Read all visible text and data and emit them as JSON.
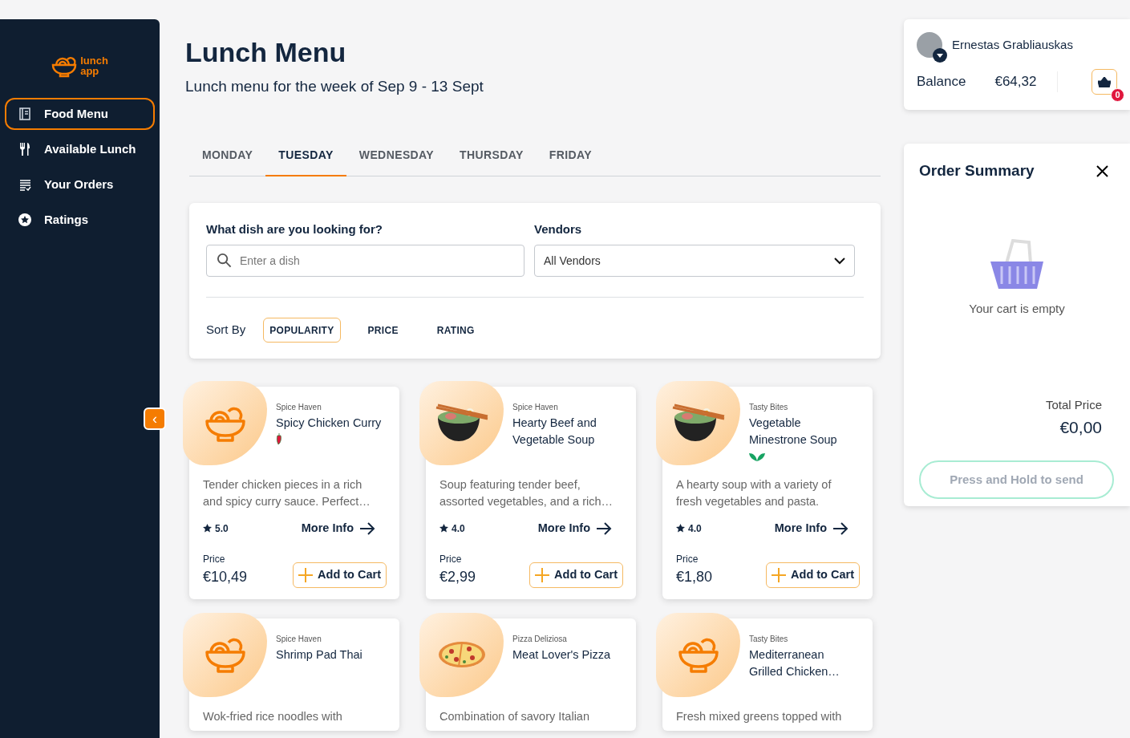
{
  "logo": {
    "line1": "lunch",
    "line2": "app"
  },
  "sidebar": {
    "items": [
      {
        "label": "Food Menu",
        "kind": "book",
        "selected": true
      },
      {
        "label": "Available Lunch",
        "kind": "cutlery",
        "selected": false
      },
      {
        "label": "Your Orders",
        "kind": "list",
        "selected": false
      },
      {
        "label": "Ratings",
        "kind": "star",
        "selected": false
      }
    ]
  },
  "collapse_button": "‹",
  "header": {
    "title": "Lunch Menu",
    "subtitle": "Lunch menu for the week of Sep 9 - 13 Sept"
  },
  "tabs": [
    {
      "label": "MONDAY",
      "selected": false
    },
    {
      "label": "TUESDAY",
      "selected": true
    },
    {
      "label": "WEDNESDAY",
      "selected": false
    },
    {
      "label": "THURSDAY",
      "selected": false
    },
    {
      "label": "FRIDAY",
      "selected": false
    }
  ],
  "filters": {
    "search_label": "What dish are you looking for?",
    "search": {
      "placeholder": "Enter a dish"
    },
    "vendor_label": "Vendors",
    "vendor": {
      "value": "All Vendors"
    },
    "sort_label": "Sort By",
    "sort_options": [
      {
        "label": "POPULARITY",
        "selected": true
      },
      {
        "label": "PRICE",
        "selected": false
      },
      {
        "label": "RATING",
        "selected": false
      }
    ]
  },
  "dishes": [
    {
      "kind": "noodles",
      "vendor": "Spice Haven",
      "name": "Spicy Chicken Curry",
      "spicy": true,
      "vegetarian": false,
      "description": "Tender chicken pieces in a rich and spicy curry sauce. Perfect…",
      "rating": "5.0",
      "more": "More Info",
      "price_label": "Price",
      "price": "€10,49",
      "add": "Add to Cart"
    },
    {
      "kind": "soup",
      "vendor": "Spice Haven",
      "name": "Hearty Beef and Vegetable Soup",
      "spicy": false,
      "vegetarian": false,
      "description": "Soup featuring tender beef, assorted vegetables, and a rich…",
      "rating": "4.0",
      "more": "More Info",
      "price_label": "Price",
      "price": "€2,99",
      "add": "Add to Cart"
    },
    {
      "kind": "soup",
      "vendor": "Tasty Bites",
      "name": "Vegetable Minestrone Soup",
      "spicy": false,
      "vegetarian": true,
      "description": "A hearty soup with a variety of fresh vegetables and pasta.",
      "rating": "4.0",
      "more": "More Info",
      "price_label": "Price",
      "price": "€1,80",
      "add": "Add to Cart"
    },
    {
      "kind": "noodles",
      "vendor": "Spice Haven",
      "name": "Shrimp Pad Thai",
      "spicy": false,
      "vegetarian": false,
      "description": "Wok-fried rice noodles with"
    },
    {
      "kind": "pizza",
      "vendor": "Pizza Deliziosa",
      "name": "Meat Lover's Pizza",
      "spicy": false,
      "vegetarian": false,
      "description": "Combination of savory Italian"
    },
    {
      "kind": "noodles",
      "vendor": "Tasty Bites",
      "name": "Mediterranean Grilled Chicken…",
      "spicy": false,
      "vegetarian": false,
      "description": "Fresh mixed greens topped with"
    }
  ],
  "user": {
    "name": "Ernestas Grabliauskas",
    "balance_label": "Balance",
    "balance": "€64,32",
    "cart_count": "0"
  },
  "order_summary": {
    "title": "Order Summary",
    "empty_text": "Your cart is empty",
    "total_label": "Total Price",
    "total": "€0,00",
    "send_button": "Press and Hold to send"
  }
}
